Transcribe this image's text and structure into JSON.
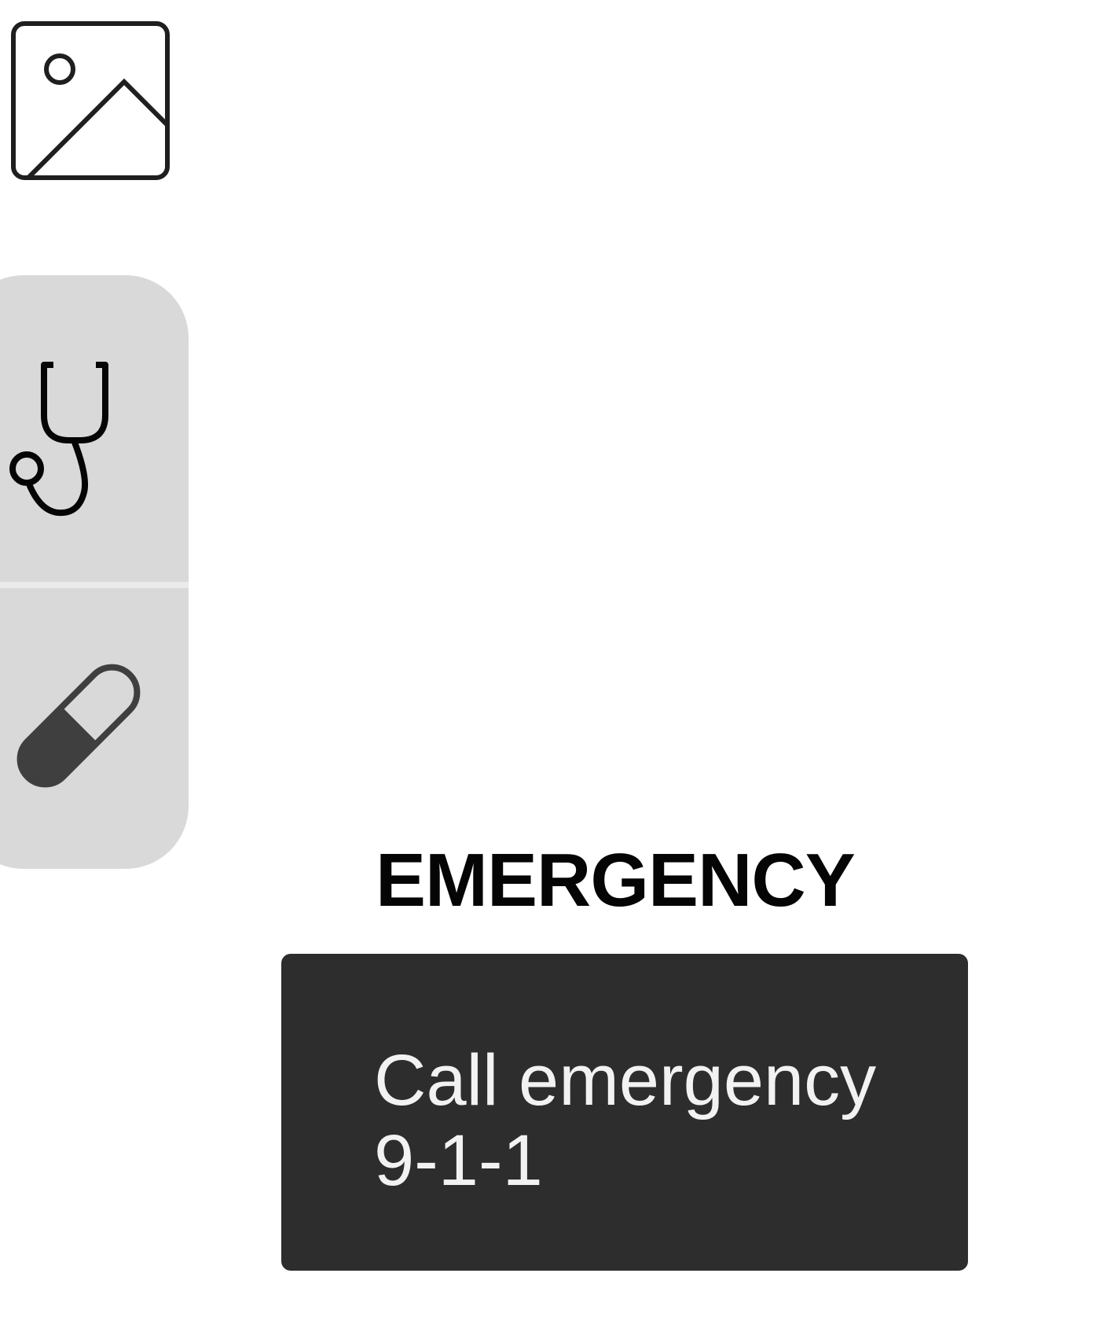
{
  "placeholder_image": {
    "icon": "image-placeholder-icon"
  },
  "side_panel": {
    "items": [
      {
        "icon": "stethoscope-icon"
      },
      {
        "icon": "pill-capsule-icon"
      }
    ]
  },
  "emergency": {
    "title": "EMERGENCY",
    "call_line1": "Call emergency",
    "call_line2": "9-1-1"
  },
  "colors": {
    "background": "#ffffff",
    "panel": "#d9d9d9",
    "card": "#2d2d2d",
    "card_text": "#f2f2f2",
    "title": "#050505",
    "icon": "#1f1f1f"
  }
}
